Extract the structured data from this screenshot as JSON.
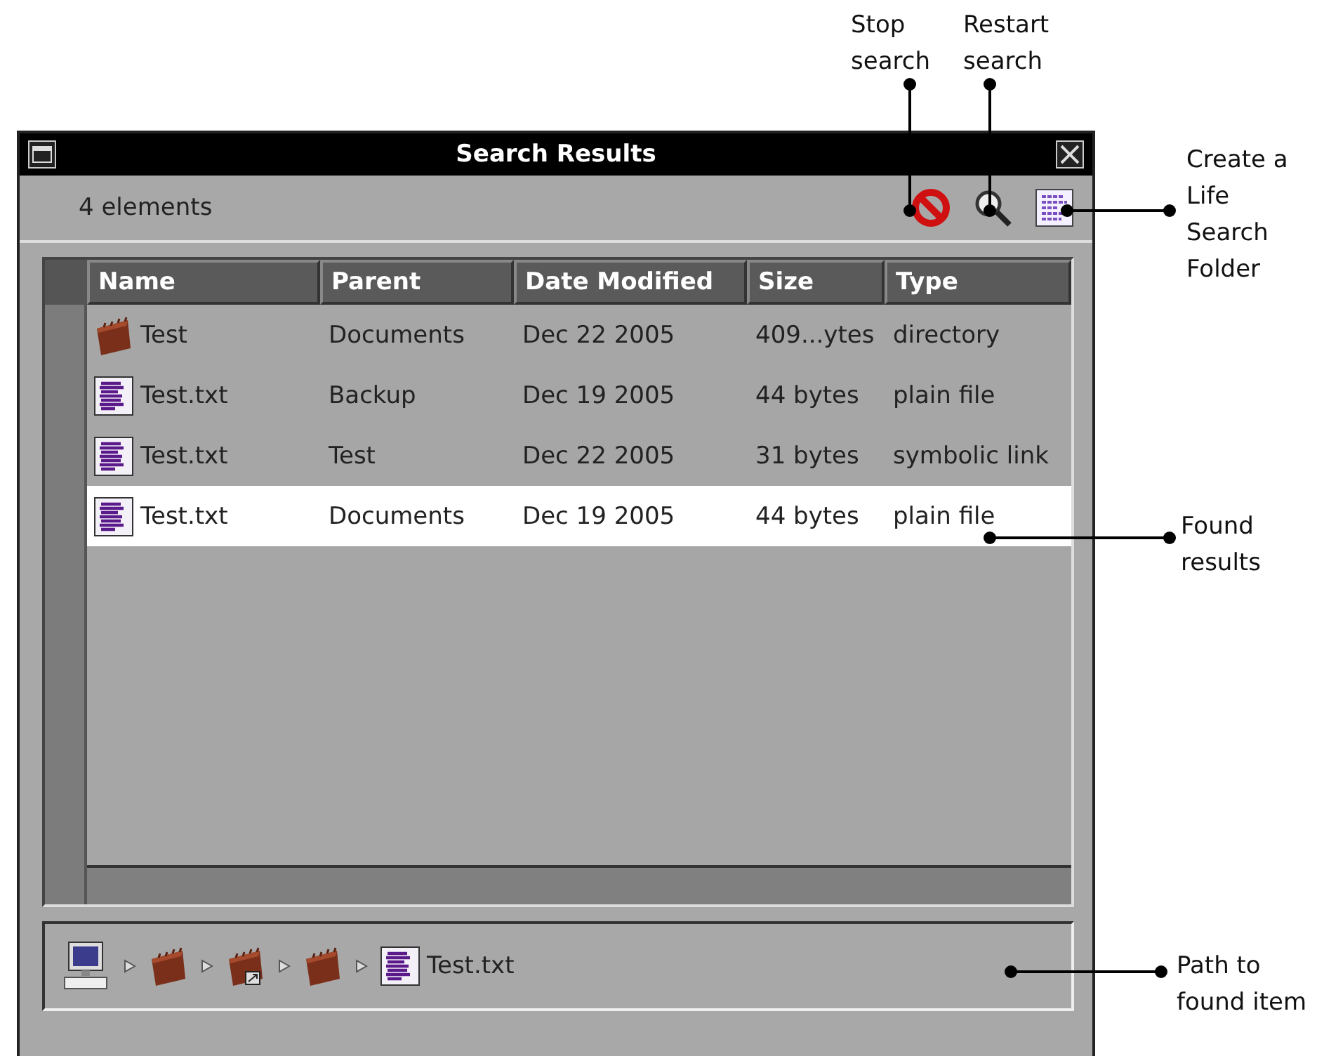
{
  "window": {
    "title": "Search Results"
  },
  "toolbar": {
    "count": "4 elements"
  },
  "table": {
    "columns": [
      "Name",
      "Parent",
      "Date Modified",
      "Size",
      "Type"
    ],
    "rows": [
      {
        "kind": "folder",
        "name": "Test",
        "parent": "Documents",
        "date": "Dec 22 2005",
        "size": "409...ytes",
        "type": "directory",
        "selected": false
      },
      {
        "kind": "file",
        "name": "Test.txt",
        "parent": "Backup",
        "date": "Dec 19 2005",
        "size": "44 bytes",
        "type": "plain file",
        "selected": false
      },
      {
        "kind": "file",
        "name": "Test.txt",
        "parent": "Test",
        "date": "Dec 22 2005",
        "size": "31 bytes",
        "type": "symbolic link",
        "selected": false
      },
      {
        "kind": "file",
        "name": "Test.txt",
        "parent": "Documents",
        "date": "Dec 19 2005",
        "size": "44 bytes",
        "type": "plain file",
        "selected": true
      }
    ]
  },
  "path": [
    {
      "kind": "computer"
    },
    {
      "kind": "folder"
    },
    {
      "kind": "linked-folder"
    },
    {
      "kind": "folder"
    },
    {
      "kind": "file",
      "label": "Test.txt"
    }
  ],
  "annotations": [
    {
      "lines": [
        "Stop",
        "search"
      ]
    },
    {
      "lines": [
        "Restart",
        "search"
      ]
    },
    {
      "lines": [
        "Create a",
        "Life",
        "Search",
        "Folder"
      ]
    },
    {
      "lines": [
        "Found",
        "results"
      ]
    },
    {
      "lines": [
        "Path to",
        "found item"
      ]
    }
  ]
}
